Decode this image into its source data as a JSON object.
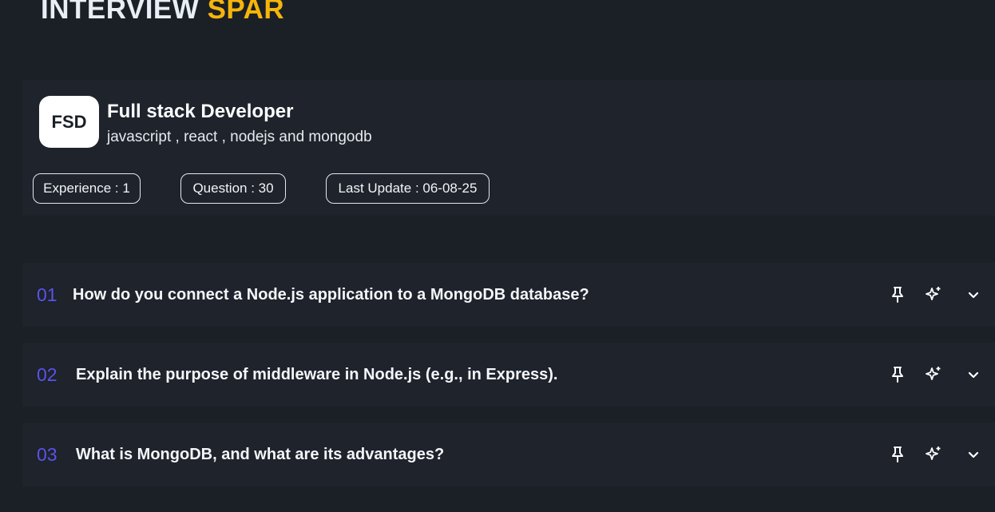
{
  "brand": {
    "part1": "INTERVIEW",
    "part2": "SPAR"
  },
  "profile": {
    "badge": "FSD",
    "title": "Full stack Developer",
    "subtitle": "javascript , react , nodejs and mongodb",
    "pills": {
      "experience": "Experience : 1",
      "questions": "Question : 30",
      "last_update": "Last Update : 06-08-25"
    }
  },
  "questions": [
    {
      "num": "01",
      "text": "How do you connect a Node.js application to a MongoDB database?"
    },
    {
      "num": "02",
      "text": "Explain the purpose of middleware in Node.js (e.g., in Express)."
    },
    {
      "num": "03",
      "text": "What is MongoDB, and what are its advantages?"
    }
  ],
  "icons": {
    "pin": "pin-icon",
    "ai": "sparkles-icon",
    "expand": "chevron-down-icon"
  },
  "colors": {
    "accent_brand": "#f5b50a",
    "number": "#5b52e8",
    "background": "#1b1f26",
    "card": "#1e232c"
  }
}
